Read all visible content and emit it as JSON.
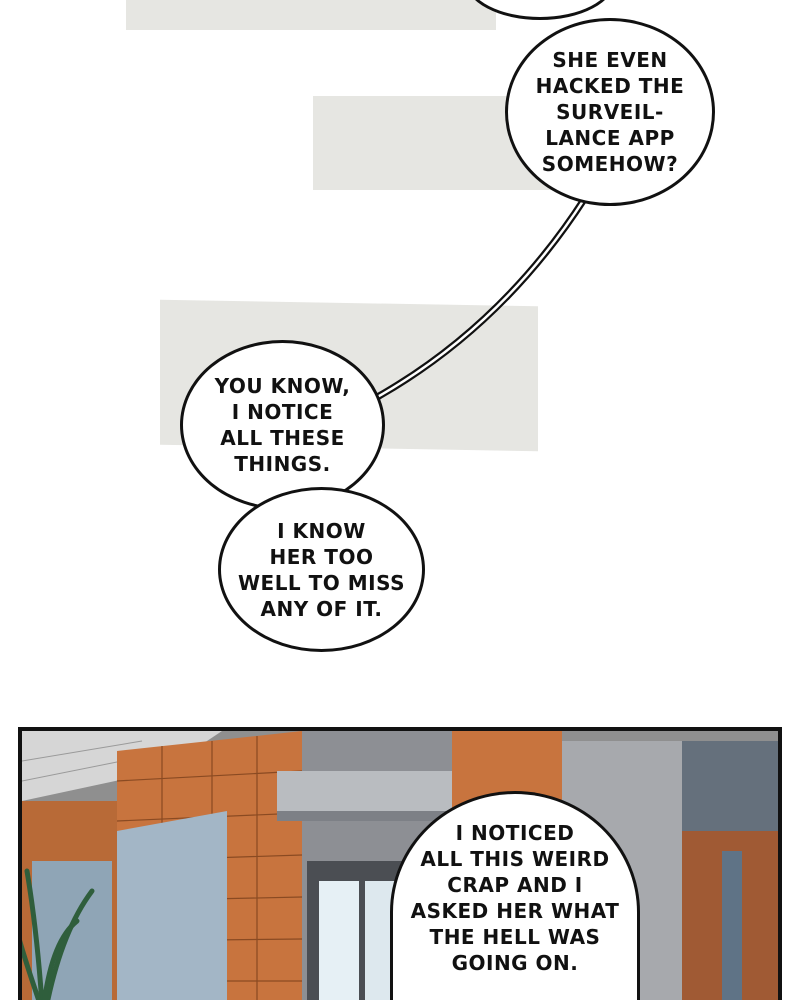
{
  "bubbles": {
    "top_partial": "",
    "hacked": "SHE EVEN\nHACKED THE\nSURVEIL-\nLANCE APP\nSOMEHOW?",
    "notice": "YOU KNOW,\nI NOTICE\nALL THESE\nTHINGS.",
    "know_her": "I KNOW\nHER TOO\nWELL TO MISS\nANY OF IT.",
    "noticed": "I NOTICED\nALL THIS WEIRD\nCRAP AND I\nASKED HER WHAT\nTHE HELL WAS\nGOING ON."
  },
  "colors": {
    "strip": "#e6e6e2",
    "brick": "#c8743e",
    "brick_dark": "#9a5428",
    "wall_gray": "#8c8e92",
    "glass": "#9fb1c2",
    "ceiling": "#d8d8d8",
    "plant": "#2f5e3c"
  }
}
